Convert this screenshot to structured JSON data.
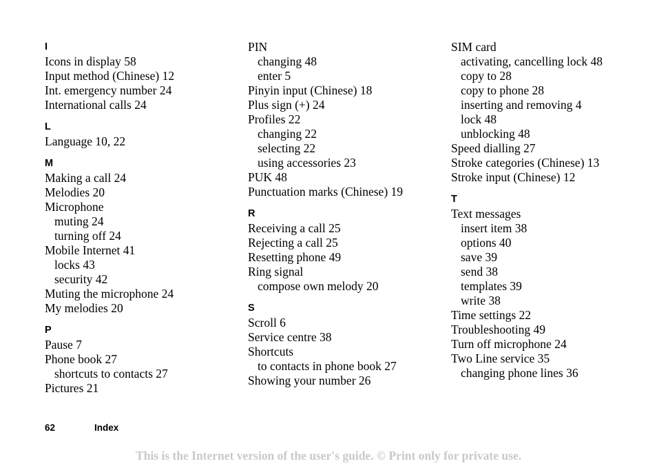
{
  "document": {
    "page_number": "62",
    "page_label": "Index",
    "disclaimer": "This is the Internet version of the user's guide. © Print only for private use.",
    "background_color": "#ffffff",
    "text_color": "#000000",
    "disclaimer_color": "#c9c9c9"
  },
  "columns": [
    {
      "sections": [
        {
          "letter": "I",
          "entries": [
            {
              "text": "Icons in display 58",
              "level": 0
            },
            {
              "text": "Input method (Chinese) 12",
              "level": 0
            },
            {
              "text": "Int. emergency number 24",
              "level": 0
            },
            {
              "text": "International calls 24",
              "level": 0
            }
          ]
        },
        {
          "letter": "L",
          "entries": [
            {
              "text": "Language 10, 22",
              "level": 0
            }
          ]
        },
        {
          "letter": "M",
          "entries": [
            {
              "text": "Making a call 24",
              "level": 0
            },
            {
              "text": "Melodies 20",
              "level": 0
            },
            {
              "text": "Microphone",
              "level": 0
            },
            {
              "text": "muting 24",
              "level": 1
            },
            {
              "text": "turning off 24",
              "level": 1
            },
            {
              "text": "Mobile Internet 41",
              "level": 0
            },
            {
              "text": "locks 43",
              "level": 1
            },
            {
              "text": "security 42",
              "level": 1
            },
            {
              "text": "Muting the microphone 24",
              "level": 0
            },
            {
              "text": "My melodies 20",
              "level": 0
            }
          ]
        },
        {
          "letter": "P",
          "entries": [
            {
              "text": "Pause 7",
              "level": 0
            },
            {
              "text": "Phone book 27",
              "level": 0
            },
            {
              "text": "shortcuts to contacts 27",
              "level": 1
            },
            {
              "text": "Pictures 21",
              "level": 0
            }
          ]
        }
      ]
    },
    {
      "sections": [
        {
          "letter": "",
          "entries": [
            {
              "text": "PIN",
              "level": 0
            },
            {
              "text": "changing 48",
              "level": 1
            },
            {
              "text": "enter 5",
              "level": 1
            },
            {
              "text": "Pinyin input (Chinese) 18",
              "level": 0
            },
            {
              "text": "Plus sign (+) 24",
              "level": 0
            },
            {
              "text": "Profiles 22",
              "level": 0
            },
            {
              "text": "changing 22",
              "level": 1
            },
            {
              "text": "selecting 22",
              "level": 1
            },
            {
              "text": "using accessories 23",
              "level": 1
            },
            {
              "text": "PUK 48",
              "level": 0
            },
            {
              "text": "Punctuation marks (Chinese) 19",
              "level": 0
            }
          ]
        },
        {
          "letter": "R",
          "entries": [
            {
              "text": "Receiving a call 25",
              "level": 0
            },
            {
              "text": "Rejecting a call 25",
              "level": 0
            },
            {
              "text": "Resetting phone 49",
              "level": 0
            },
            {
              "text": "Ring signal",
              "level": 0
            },
            {
              "text": "compose own melody 20",
              "level": 1
            }
          ]
        },
        {
          "letter": "S",
          "entries": [
            {
              "text": "Scroll 6",
              "level": 0
            },
            {
              "text": "Service centre 38",
              "level": 0
            },
            {
              "text": "Shortcuts",
              "level": 0
            },
            {
              "text": "to contacts in phone book 27",
              "level": 1
            },
            {
              "text": "Showing your number 26",
              "level": 0
            }
          ]
        }
      ]
    },
    {
      "sections": [
        {
          "letter": "",
          "entries": [
            {
              "text": "SIM card",
              "level": 0
            },
            {
              "text": "activating, cancelling lock 48",
              "level": 1
            },
            {
              "text": "copy to 28",
              "level": 1
            },
            {
              "text": "copy to phone 28",
              "level": 1
            },
            {
              "text": "inserting and removing 4",
              "level": 1
            },
            {
              "text": "lock 48",
              "level": 1
            },
            {
              "text": "unblocking 48",
              "level": 1
            },
            {
              "text": "Speed dialling 27",
              "level": 0
            },
            {
              "text": "Stroke categories (Chinese) 13",
              "level": 0
            },
            {
              "text": "Stroke input (Chinese) 12",
              "level": 0
            }
          ]
        },
        {
          "letter": "T",
          "entries": [
            {
              "text": "Text messages",
              "level": 0
            },
            {
              "text": "insert item 38",
              "level": 1
            },
            {
              "text": "options 40",
              "level": 1
            },
            {
              "text": "save 39",
              "level": 1
            },
            {
              "text": "send 38",
              "level": 1
            },
            {
              "text": "templates 39",
              "level": 1
            },
            {
              "text": "write 38",
              "level": 1
            },
            {
              "text": "Time settings 22",
              "level": 0
            },
            {
              "text": "Troubleshooting 49",
              "level": 0
            },
            {
              "text": "Turn off microphone 24",
              "level": 0
            },
            {
              "text": "Two Line service 35",
              "level": 0
            },
            {
              "text": "changing phone lines 36",
              "level": 1
            }
          ]
        }
      ]
    }
  ]
}
